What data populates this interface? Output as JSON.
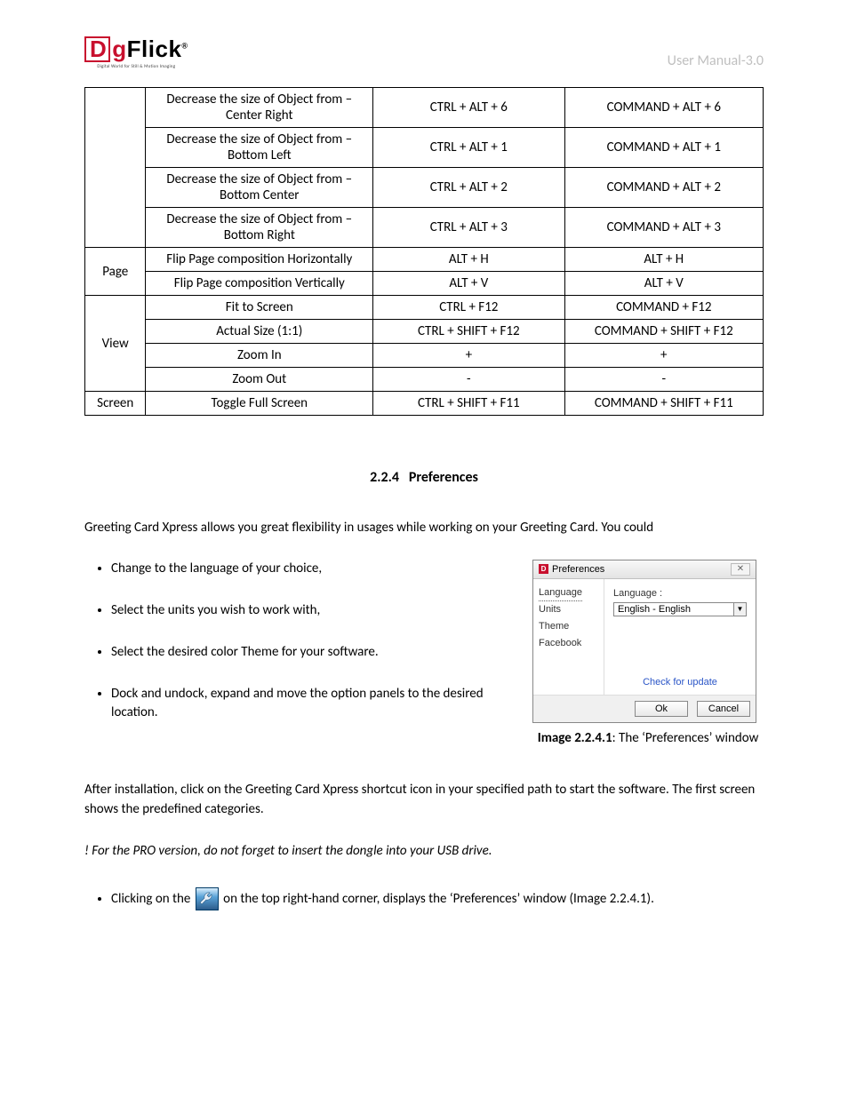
{
  "header": {
    "logo_d": "D",
    "logo_g": "g",
    "logo_flick": "Flick",
    "logo_r": "®",
    "logo_tagline": "Digital World for Still & Motion Imaging",
    "right": "User Manual-3.0"
  },
  "table": {
    "groups": [
      {
        "category": "",
        "rows": [
          {
            "desc": "Decrease the size of Object from – Center Right",
            "win": "CTRL + ALT + 6",
            "mac": "COMMAND + ALT + 6"
          },
          {
            "desc": "Decrease the size of Object from – Bottom Left",
            "win": "CTRL + ALT + 1",
            "mac": "COMMAND + ALT + 1"
          },
          {
            "desc": "Decrease the size of Object from – Bottom Center",
            "win": "CTRL + ALT + 2",
            "mac": "COMMAND + ALT + 2"
          },
          {
            "desc": "Decrease the size of Object from – Bottom Right",
            "win": "CTRL + ALT + 3",
            "mac": "COMMAND + ALT + 3"
          }
        ]
      },
      {
        "category": "Page",
        "rows": [
          {
            "desc": "Flip Page composition Horizontally",
            "win": "ALT + H",
            "mac": "ALT + H"
          },
          {
            "desc": "Flip Page composition Vertically",
            "win": "ALT + V",
            "mac": "ALT + V"
          }
        ]
      },
      {
        "category": "View",
        "rows": [
          {
            "desc": "Fit to Screen",
            "win": "CTRL + F12",
            "mac": "COMMAND + F12"
          },
          {
            "desc": "Actual Size (1:1)",
            "win": "CTRL + SHIFT + F12",
            "mac": "COMMAND + SHIFT + F12"
          },
          {
            "desc": "Zoom In",
            "win": "+",
            "mac": "+"
          },
          {
            "desc": "Zoom Out",
            "win": "-",
            "mac": "-"
          }
        ]
      },
      {
        "category": "Screen",
        "rows": [
          {
            "desc": "Toggle Full Screen",
            "win": "CTRL + SHIFT + F11",
            "mac": "COMMAND + SHIFT + F11"
          }
        ]
      }
    ]
  },
  "section": {
    "number": "2.2.4",
    "title": "Preferences"
  },
  "intro": "Greeting Card Xpress allows you great flexibility in usages while working on your Greeting Card. You could",
  "bullets": [
    "Change to the language of your choice,",
    "Select the units you wish to work with,",
    "Select the desired color Theme for your software.",
    "Dock and undock, expand and move the option panels to the desired location."
  ],
  "dialog": {
    "title": "Preferences",
    "close": "✕",
    "nav": [
      "Language",
      "Units",
      "Theme",
      "Facebook"
    ],
    "main_label": "Language :",
    "select_value": "English - English",
    "dropdown_arrow": "▼",
    "link": "Check for update",
    "ok": "Ok",
    "cancel": "Cancel"
  },
  "caption": {
    "bold": "Image 2.2.4.1",
    "rest": ": The ‘Preferences’ window"
  },
  "after": "After installation, click on the Greeting Card Xpress shortcut icon in your specified path to start the software. The first screen shows the predefined categories.",
  "note": "! For the PRO version, do not forget to insert the dongle into your USB drive.",
  "click_before": "Clicking on the ",
  "click_after": " on the top right-hand corner, displays the ‘Preferences’ window (Image 2.2.4.1)."
}
